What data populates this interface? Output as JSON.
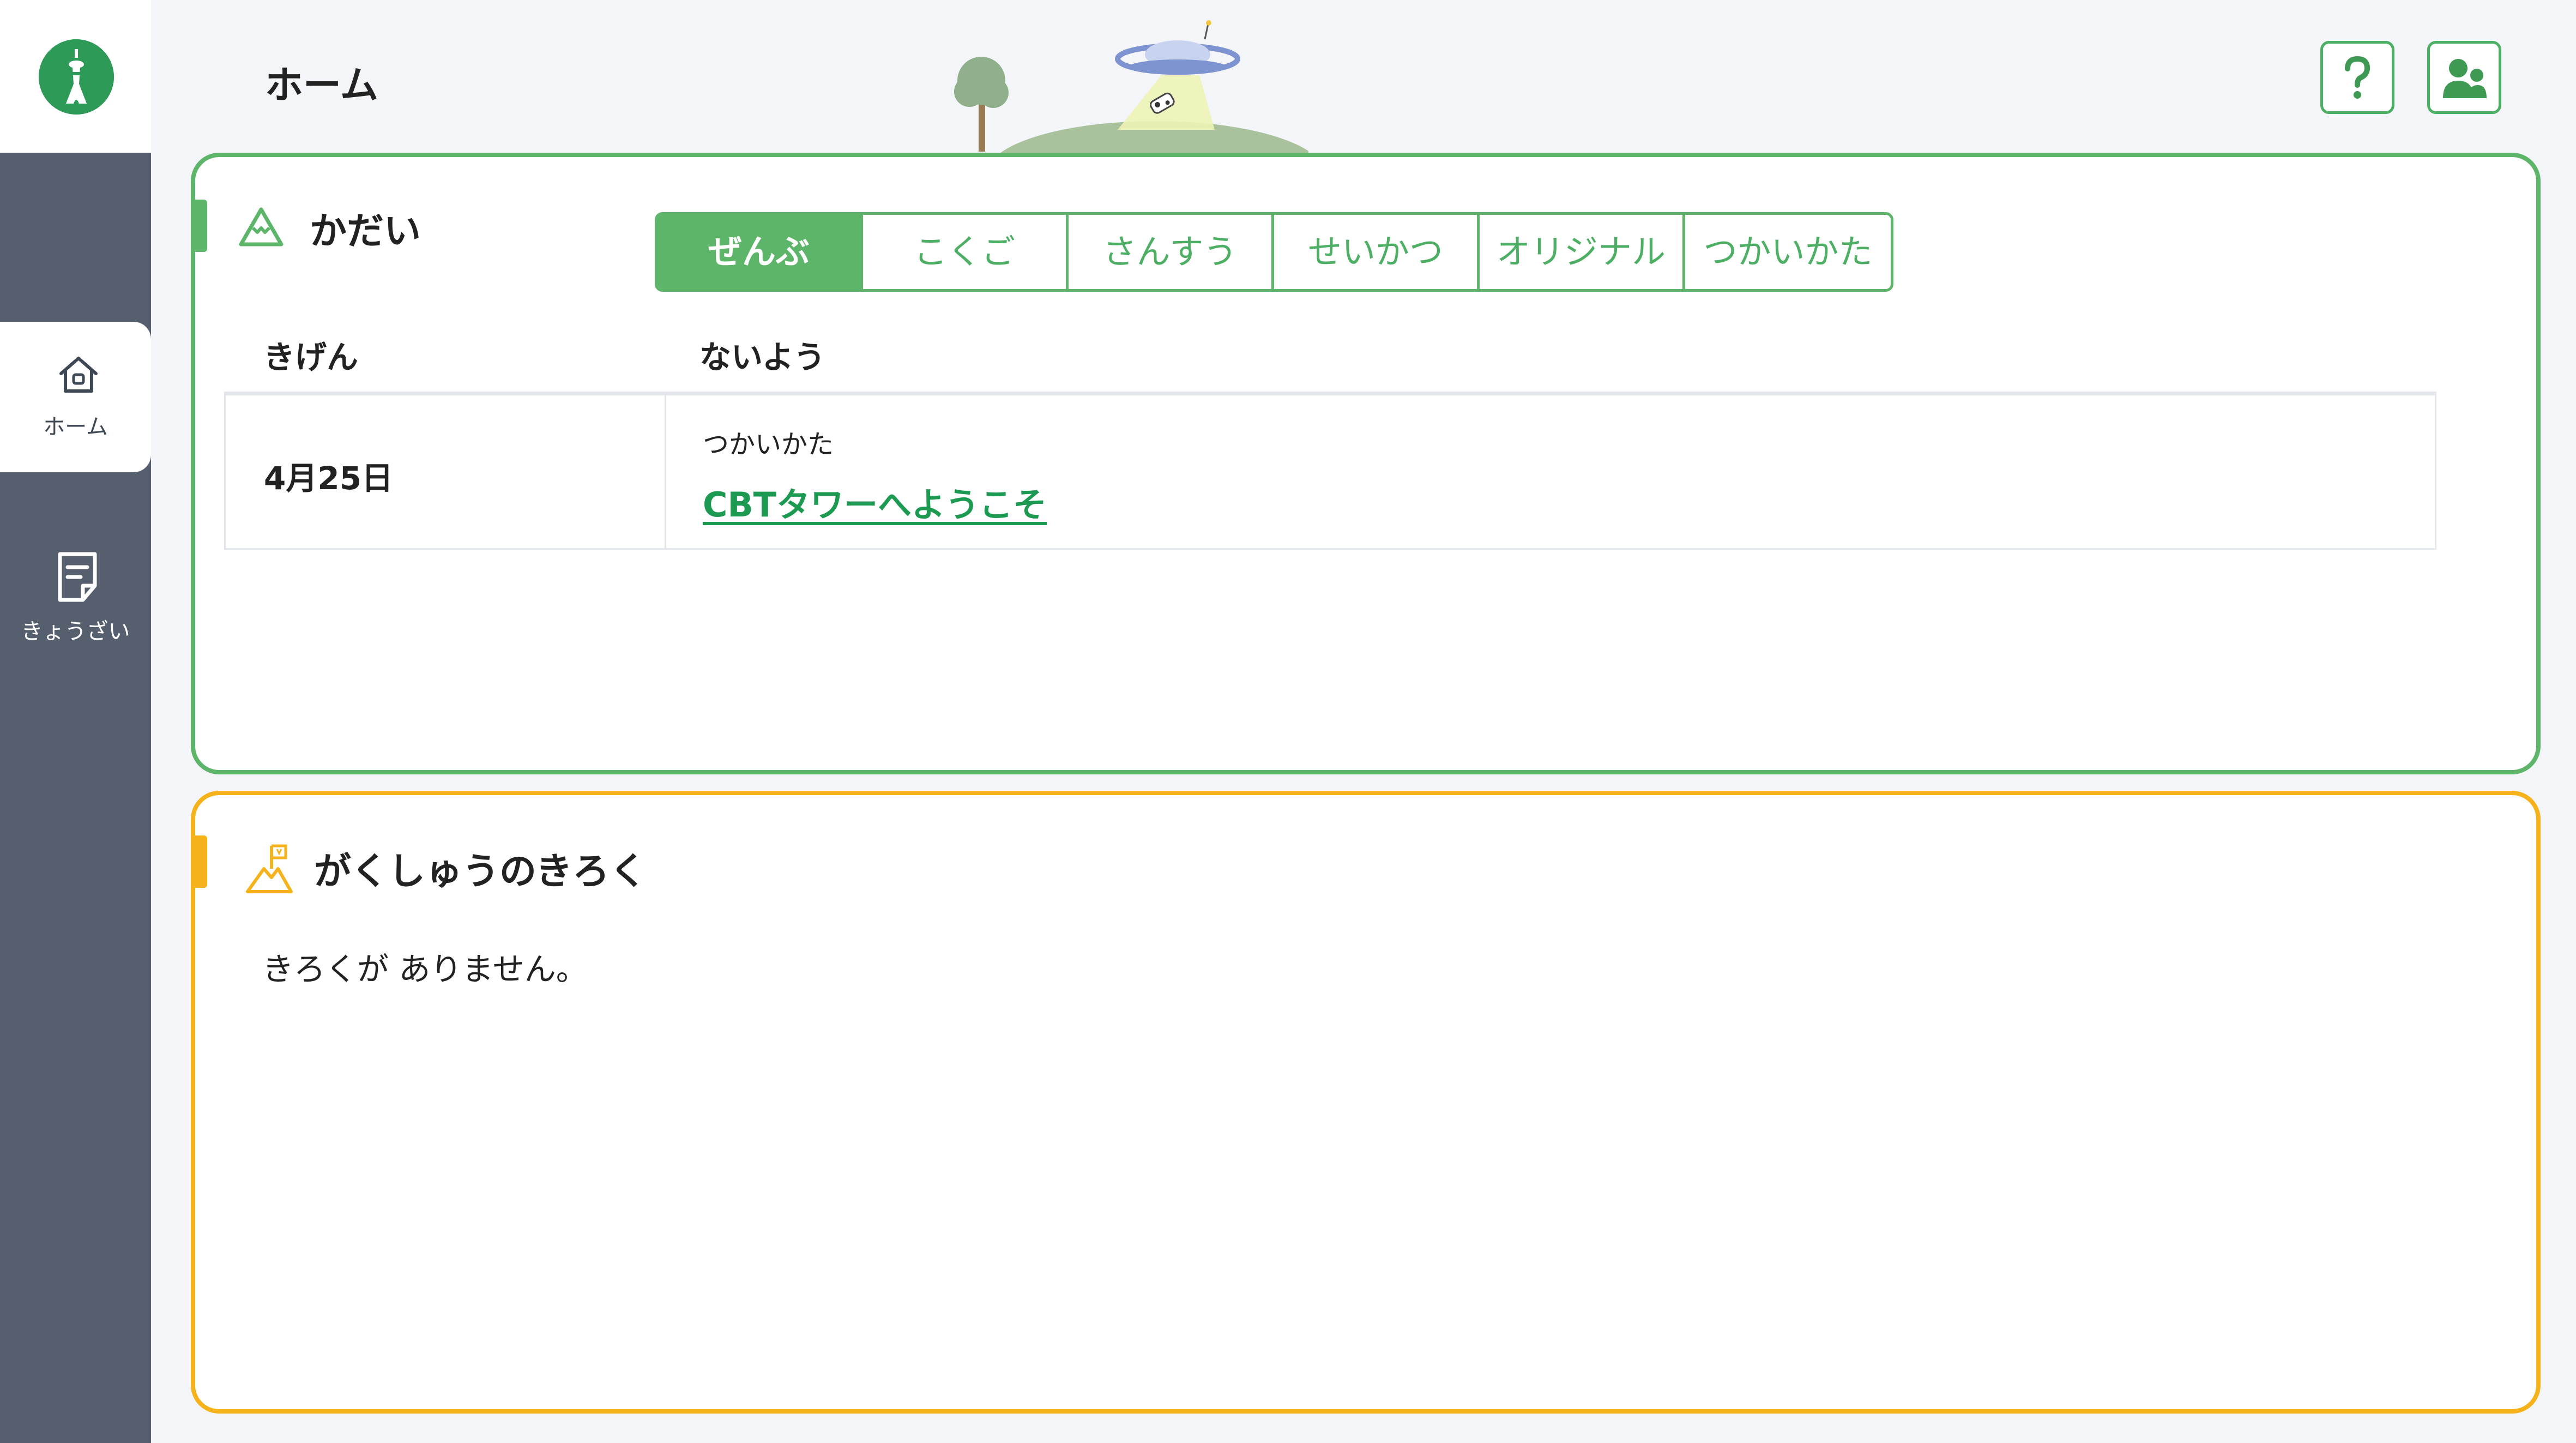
{
  "header": {
    "title": "ホーム",
    "help_icon": "question-mark-icon",
    "account_icon": "users-icon"
  },
  "sidebar": {
    "logo_icon": "tower-logo-icon",
    "items": [
      {
        "label": "ホーム",
        "icon": "house-icon",
        "active": true
      },
      {
        "label": "きょうざい",
        "icon": "document-icon",
        "active": false
      }
    ]
  },
  "tasks_panel": {
    "title": "かだい",
    "icon": "mountain-outline-icon",
    "accent_color": "#5cb568",
    "tabs": [
      {
        "label": "ぜんぶ",
        "active": true
      },
      {
        "label": "こくご",
        "active": false
      },
      {
        "label": "さんすう",
        "active": false
      },
      {
        "label": "せいかつ",
        "active": false
      },
      {
        "label": "オリジナル",
        "active": false
      },
      {
        "label": "つかいかた",
        "active": false
      }
    ],
    "columns": {
      "deadline": "きげん",
      "content": "ないよう"
    },
    "rows": [
      {
        "deadline": "4月25日",
        "category": "つかいかた",
        "title": "CBTタワーへようこそ"
      }
    ]
  },
  "records_panel": {
    "title": "がくしゅうのきろく",
    "icon": "mountain-flag-icon",
    "accent_color": "#f5b21a",
    "empty_message": "きろくが ありません。"
  }
}
